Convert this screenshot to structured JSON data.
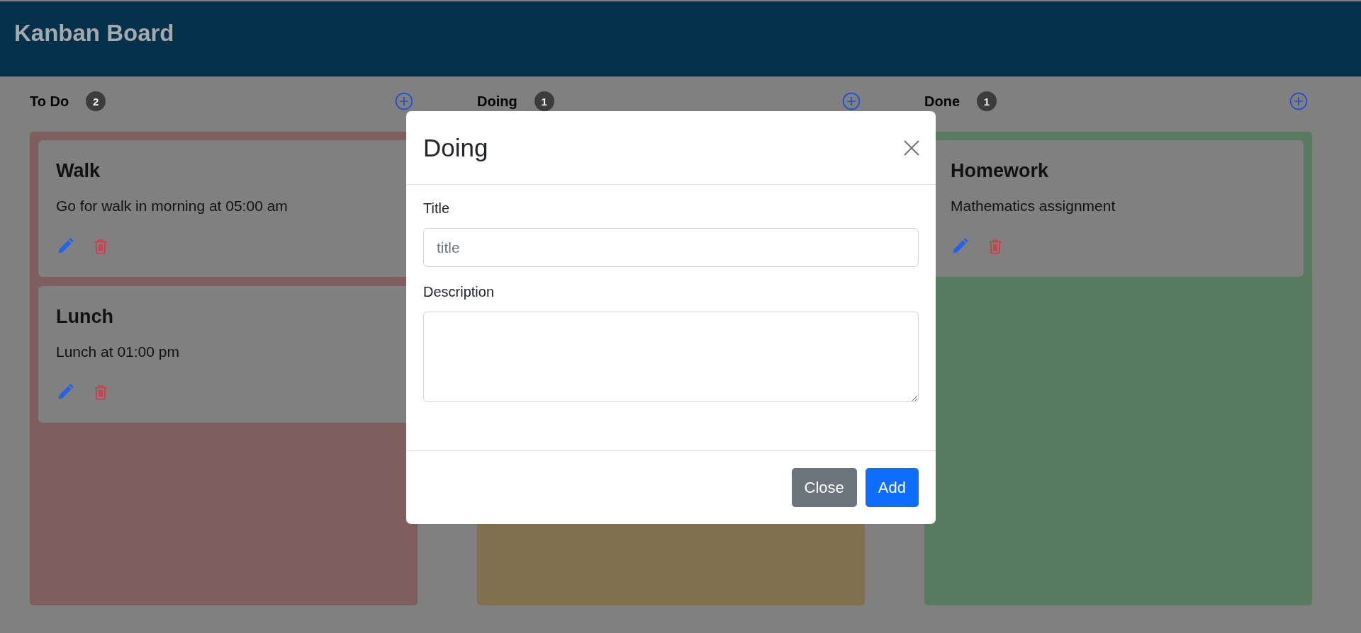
{
  "header": {
    "title": "Kanban Board"
  },
  "columns": [
    {
      "title": "To Do",
      "count": "2",
      "color": "#7f5e60",
      "cards": [
        {
          "title": "Walk",
          "description": "Go for walk in morning at 05:00 am"
        },
        {
          "title": "Lunch",
          "description": "Lunch at 01:00 pm"
        }
      ]
    },
    {
      "title": "Doing",
      "count": "1",
      "color": "#80704f"
    },
    {
      "title": "Done",
      "count": "1",
      "color": "#587a60",
      "cards": [
        {
          "title": "Homework",
          "description": "Mathematics assignment"
        }
      ]
    }
  ],
  "modal": {
    "title": "Doing",
    "fields": [
      {
        "label": "Title",
        "placeholder": "title",
        "kind": "input"
      },
      {
        "label": "Description",
        "kind": "textarea"
      }
    ],
    "buttons": [
      {
        "label": "Close",
        "kind": "secondary"
      },
      {
        "label": "Add",
        "kind": "primary"
      }
    ]
  }
}
